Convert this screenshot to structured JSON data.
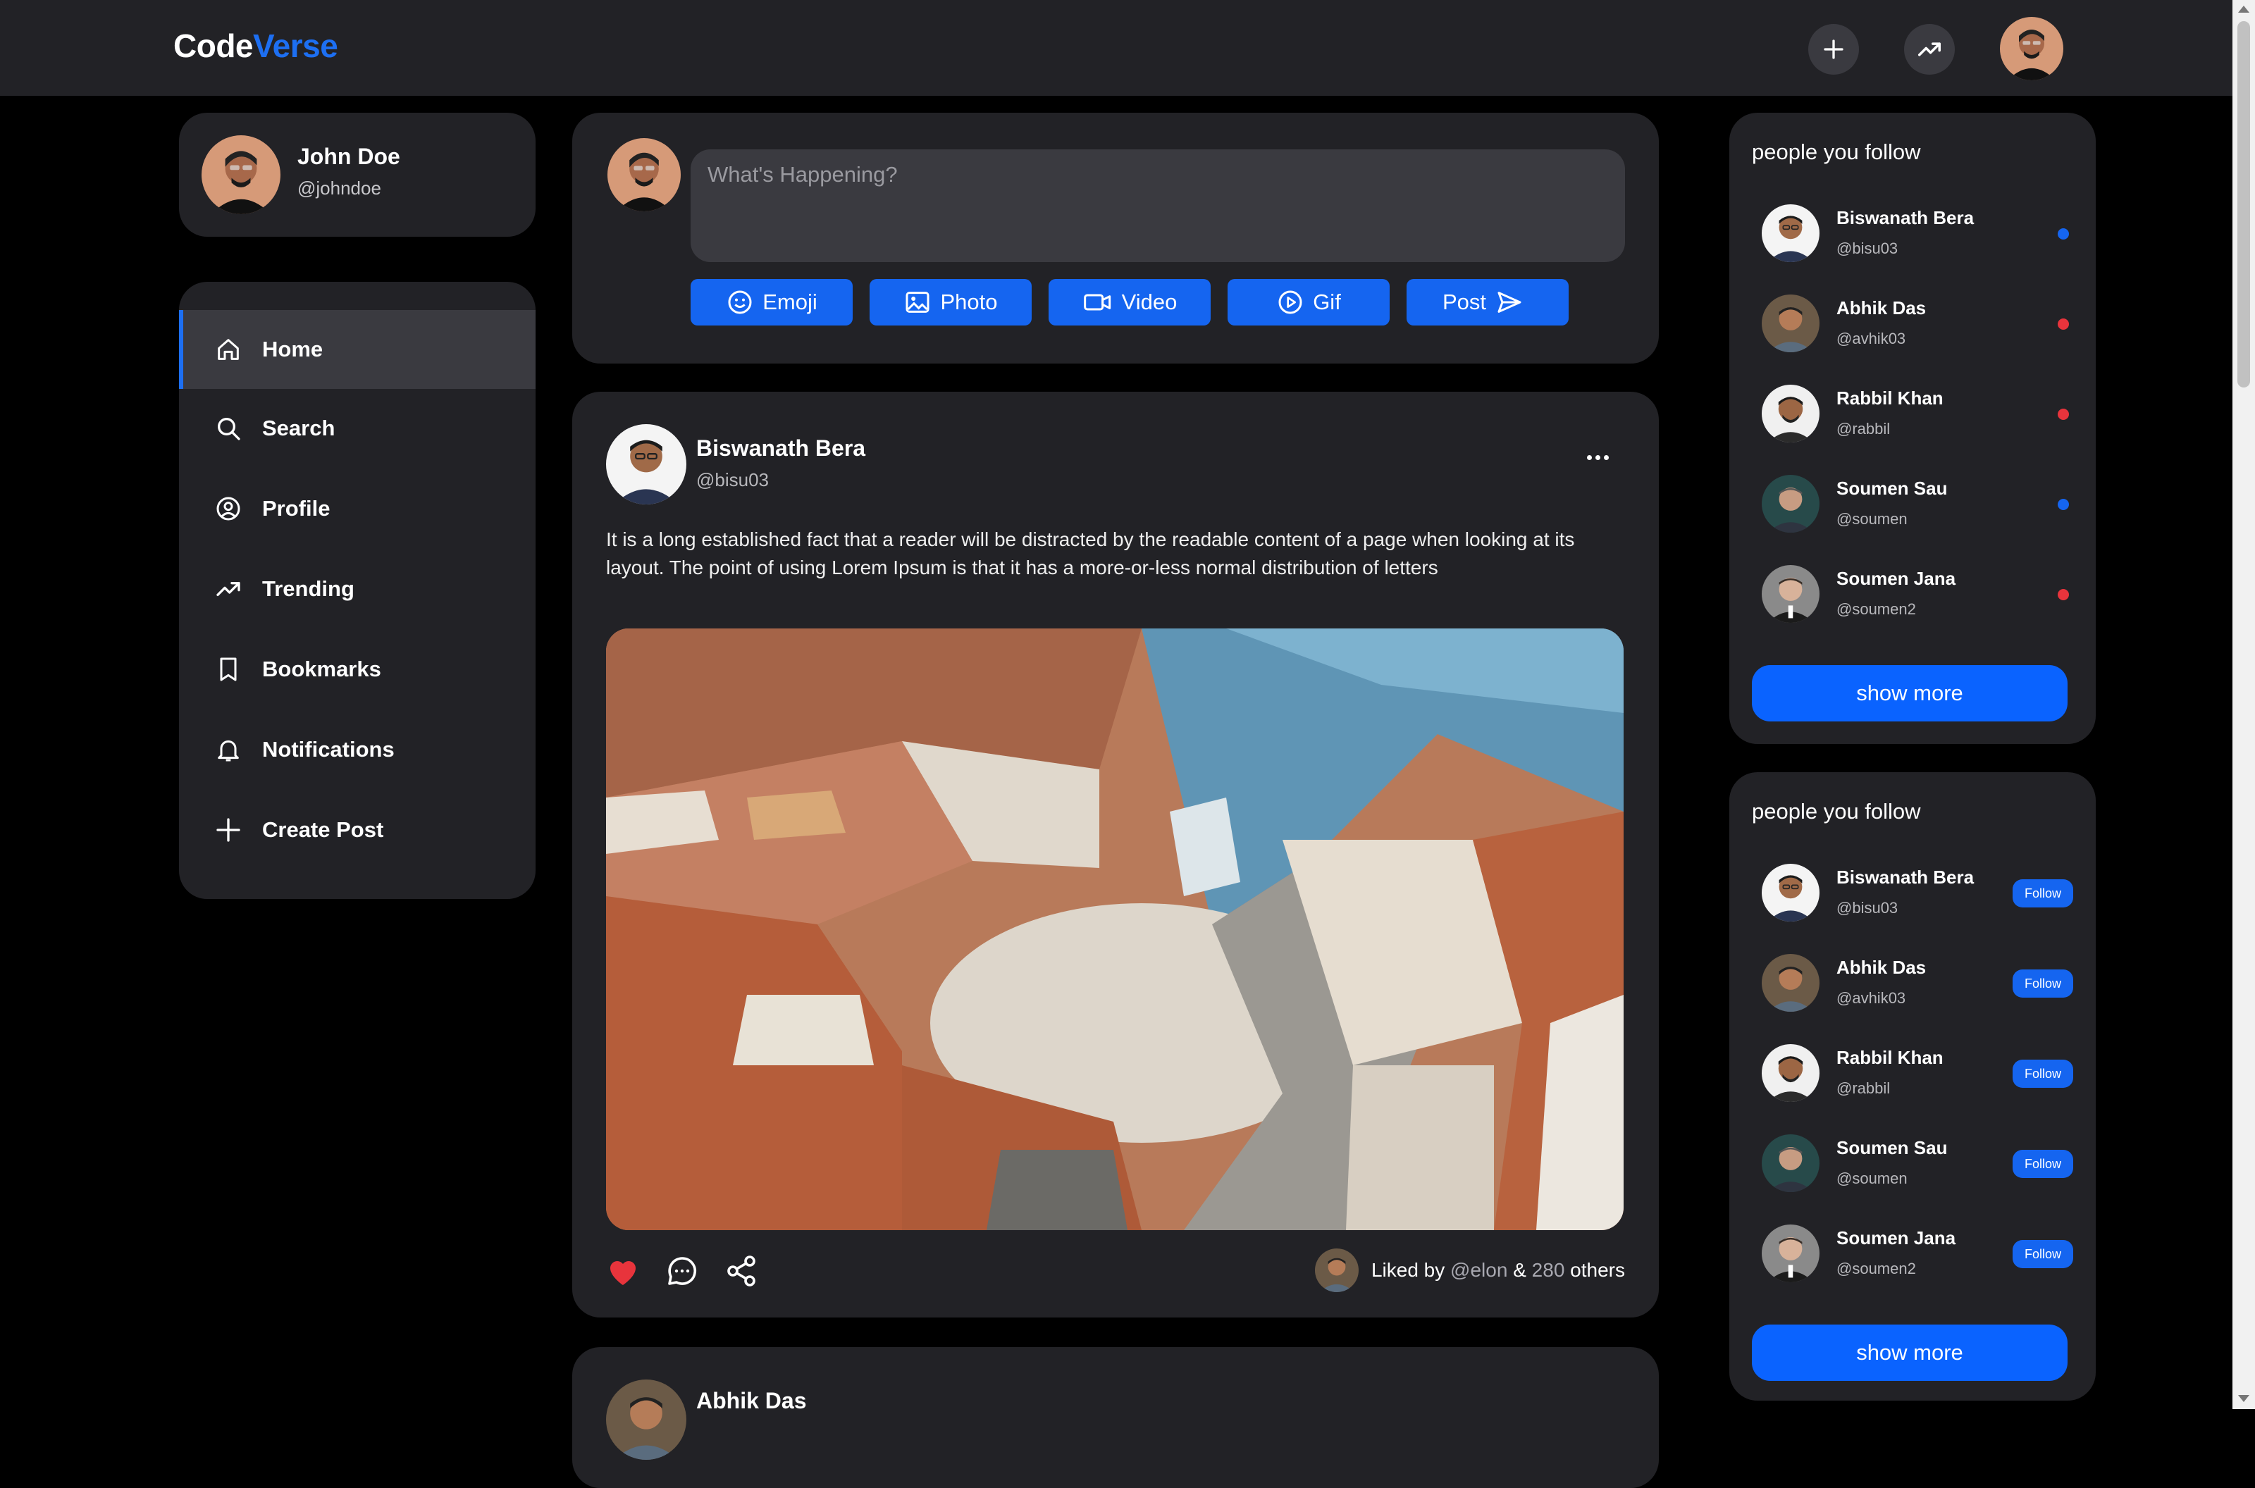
{
  "app": {
    "logo_part1": "Code",
    "logo_part2": "Verse"
  },
  "current_user": {
    "name": "John Doe",
    "handle": "@johndoe"
  },
  "nav": [
    {
      "label": "Home",
      "icon": "home-icon",
      "active": true
    },
    {
      "label": "Search",
      "icon": "search-icon"
    },
    {
      "label": "Profile",
      "icon": "profile-icon"
    },
    {
      "label": "Trending",
      "icon": "trending-icon"
    },
    {
      "label": "Bookmarks",
      "icon": "bookmark-icon"
    },
    {
      "label": "Notifications",
      "icon": "bell-icon"
    },
    {
      "label": "Create Post",
      "icon": "plus-icon"
    }
  ],
  "composer": {
    "placeholder": "What's Happening?",
    "buttons": [
      {
        "label": "Emoji",
        "icon": "emoji-icon"
      },
      {
        "label": "Photo",
        "icon": "photo-icon"
      },
      {
        "label": "Video",
        "icon": "video-icon"
      },
      {
        "label": "Gif",
        "icon": "gif-icon"
      },
      {
        "label": "Post",
        "icon": "send-icon"
      }
    ]
  },
  "posts": [
    {
      "author": "Biswanath Bera",
      "handle": "@bisu03",
      "text": "It is a long established fact that a reader will be distracted by the readable content of a page when looking at its layout. The point of using Lorem Ipsum is that it has a more-or-less normal distribution of letters",
      "liked_prefix": "Liked by",
      "liked_user": "@elon",
      "liked_amp": "&",
      "liked_count": "280",
      "liked_suffix": "others"
    },
    {
      "author": "Abhik Das"
    }
  ],
  "following": {
    "title": "people you follow",
    "people": [
      {
        "name": "Biswanath Bera",
        "handle": "@bisu03",
        "status": "#1565f0"
      },
      {
        "name": "Abhik Das",
        "handle": "@avhik03",
        "status": "#e8343c"
      },
      {
        "name": "Rabbil Khan",
        "handle": "@rabbil",
        "status": "#e8343c"
      },
      {
        "name": "Soumen Sau",
        "handle": "@soumen",
        "status": "#1565f0"
      },
      {
        "name": "Soumen Jana",
        "handle": "@soumen2",
        "status": "#e8343c"
      }
    ],
    "show_more": "show more"
  },
  "suggestions": {
    "title": "people you follow",
    "follow_label": "Follow",
    "people": [
      {
        "name": "Biswanath Bera",
        "handle": "@bisu03"
      },
      {
        "name": "Abhik Das",
        "handle": "@avhik03"
      },
      {
        "name": "Rabbil Khan",
        "handle": "@rabbil"
      },
      {
        "name": "Soumen Sau",
        "handle": "@soumen"
      },
      {
        "name": "Soumen Jana",
        "handle": "@soumen2"
      }
    ],
    "show_more": "show more"
  },
  "colors": {
    "accent": "#1565f0",
    "like": "#e8343c",
    "background": "#000000",
    "card": "#222226"
  }
}
